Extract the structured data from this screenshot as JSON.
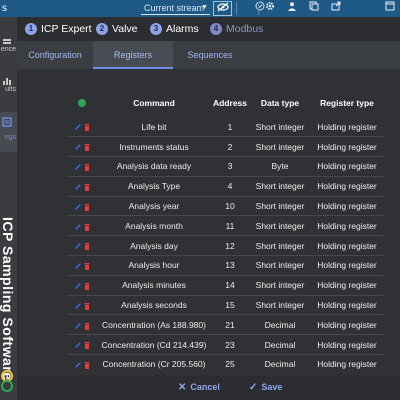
{
  "topbar": {
    "left_letter": "s",
    "stream_label": "Current stream",
    "icons": [
      "eye-off-icon",
      "check-circle-icon",
      "gear-icon",
      "user-icon",
      "copy-icon",
      "export-icon",
      "window-icon"
    ]
  },
  "rail": {
    "items": [
      "ence",
      "ults",
      "ngs"
    ],
    "brand_text": "ICP Sampling Software"
  },
  "steps": [
    {
      "num": "1",
      "label": "ICP Expert"
    },
    {
      "num": "2",
      "label": "Valve"
    },
    {
      "num": "3",
      "label": "Alarms"
    },
    {
      "num": "4",
      "label": "Modbus"
    }
  ],
  "subtabs": [
    "Configuration",
    "Registers",
    "Sequences"
  ],
  "table": {
    "headers": {
      "command": "Command",
      "address": "Address",
      "data_type": "Data type",
      "register_type": "Register type"
    },
    "rows": [
      {
        "command": "Life bit",
        "address": "1",
        "data_type": "Short integer",
        "register_type": "Holding register"
      },
      {
        "command": "Instruments status",
        "address": "2",
        "data_type": "Short integer",
        "register_type": "Holding register"
      },
      {
        "command": "Analysis data ready",
        "address": "3",
        "data_type": "Byte",
        "register_type": "Holding register"
      },
      {
        "command": "Analysis Type",
        "address": "4",
        "data_type": "Short integer",
        "register_type": "Holding register"
      },
      {
        "command": "Analysis year",
        "address": "10",
        "data_type": "Short integer",
        "register_type": "Holding register"
      },
      {
        "command": "Analysis month",
        "address": "11",
        "data_type": "Short integer",
        "register_type": "Holding register"
      },
      {
        "command": "Analysis day",
        "address": "12",
        "data_type": "Short integer",
        "register_type": "Holding register"
      },
      {
        "command": "Analysis hour",
        "address": "13",
        "data_type": "Short integer",
        "register_type": "Holding register"
      },
      {
        "command": "Analysis minutes",
        "address": "14",
        "data_type": "Short integer",
        "register_type": "Holding register"
      },
      {
        "command": "Analysis seconds",
        "address": "15",
        "data_type": "Short integer",
        "register_type": "Holding register"
      },
      {
        "command": "Concentration (As 188.980)",
        "address": "21",
        "data_type": "Decimal",
        "register_type": "Holding register"
      },
      {
        "command": "Concentration (Cd 214.439)",
        "address": "23",
        "data_type": "Decimal",
        "register_type": "Holding register"
      },
      {
        "command": "Concentration (Cr 205.560)",
        "address": "25",
        "data_type": "Decimal",
        "register_type": "Holding register"
      }
    ]
  },
  "footer": {
    "cancel_label": "Cancel",
    "save_label": "Save"
  },
  "colors": {
    "accent": "#8fa6ee",
    "topbar": "#1f5a86",
    "edit": "#3d6cf0",
    "delete": "#e23b3b",
    "status_ok": "#2fa84f"
  }
}
